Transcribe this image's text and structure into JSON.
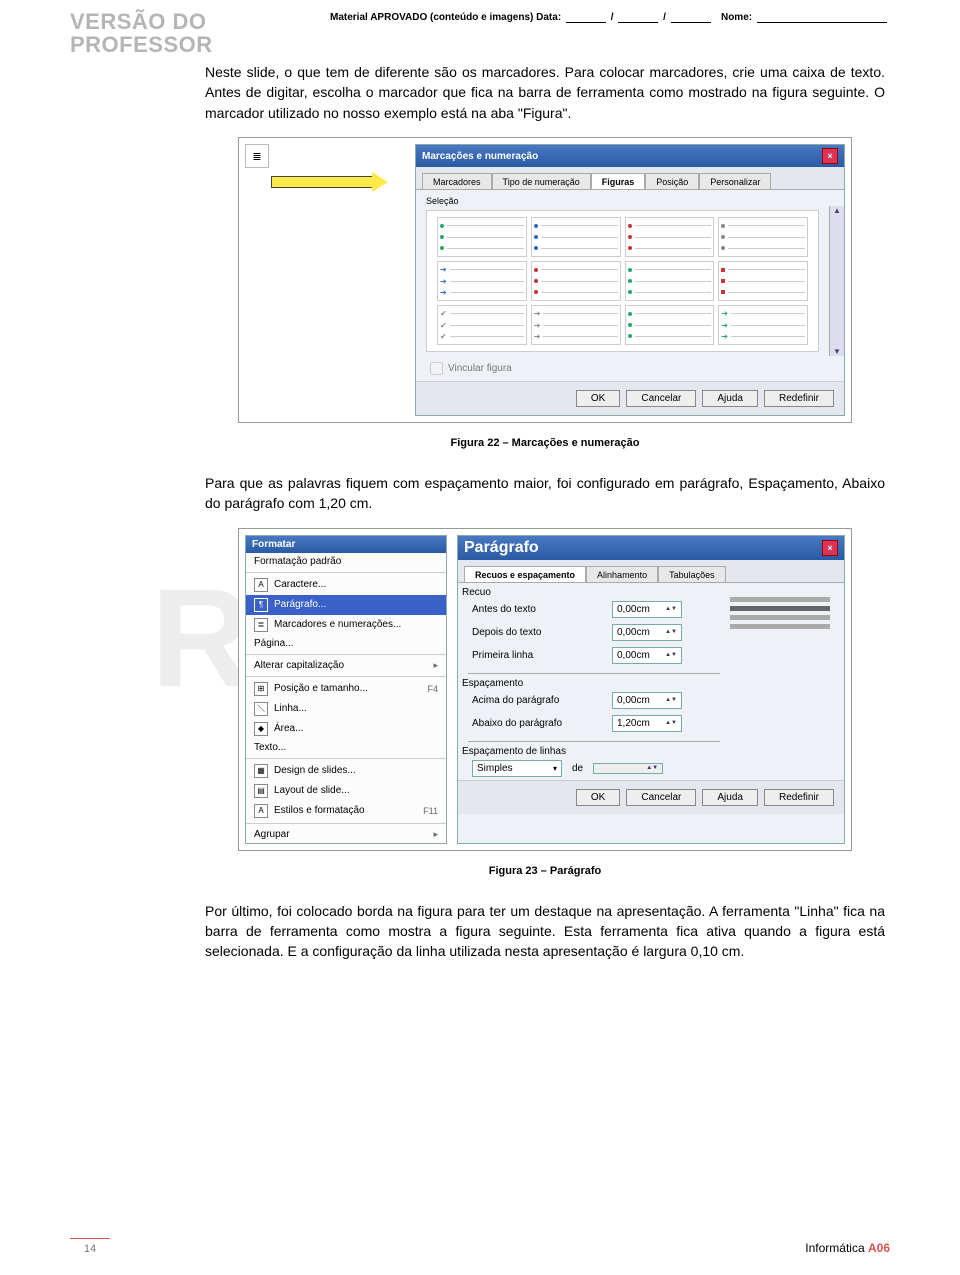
{
  "header": {
    "stamp_line1": "VERSÃO DO",
    "stamp_line2": "PROFESSOR",
    "approval_prefix": "Material APROVADO (conteúdo e imagens)  Data:",
    "approval_nome": "Nome:",
    "slash": "/"
  },
  "watermark": "REVISÃO",
  "para1": "Neste slide, o que tem de diferente são os marcadores. Para colocar marcadores, crie uma caixa de texto. Antes de digitar, escolha o marcador que fica na barra de ferramenta como mostrado na figura seguinte. O marcador utilizado no nosso exemplo está na aba \"Figura\".",
  "fig22": {
    "title": "Marcações e numeração",
    "tabs": [
      "Marcadores",
      "Tipo de numeração",
      "Figuras",
      "Posição",
      "Personalizar"
    ],
    "section": "Seleção",
    "link_check": "Vincular figura",
    "buttons": {
      "ok": "OK",
      "cancel": "Cancelar",
      "help": "Ajuda",
      "reset": "Redefinir"
    },
    "caption": "Figura 22 – Marcações e numeração"
  },
  "para2": "Para que as palavras fiquem com espaçamento maior, foi configurado em parágrafo, Espaçamento, Abaixo do parágrafo com 1,20 cm.",
  "fig23": {
    "menu_title": "Formatar",
    "menu_items": [
      "Formatação padrão",
      "Caractere...",
      "Parágrafo...",
      "Marcadores e numerações...",
      "Página...",
      "Alterar capitalização",
      "Posição e tamanho...",
      "Linha...",
      "Área...",
      "Texto...",
      "Design de slides...",
      "Layout de slide...",
      "Estilos e formatação",
      "Agrupar"
    ],
    "menu_short_f4": "F4",
    "menu_short_f11": "F11",
    "dlg_title": "Parágrafo",
    "dlg_tabs": [
      "Recuos e espaçamento",
      "Alinhamento",
      "Tabulações"
    ],
    "grp_recuo": "Recuo",
    "lbl_antes": "Antes do texto",
    "lbl_depois": "Depois do texto",
    "lbl_primeira": "Primeira linha",
    "grp_espac": "Espaçamento",
    "lbl_acima": "Acima do parágrafo",
    "lbl_abaixo": "Abaixo do parágrafo",
    "grp_linhas": "Espaçamento de linhas",
    "val_simples": "Simples",
    "v000": "0,00cm",
    "v120": "1,20cm",
    "de": "de",
    "buttons": {
      "ok": "OK",
      "cancel": "Cancelar",
      "help": "Ajuda",
      "reset": "Redefinir"
    },
    "caption": "Figura 23 – Parágrafo"
  },
  "para3": "Por último, foi colocado borda na figura para ter um destaque na apresentação. A ferramenta \"Linha\" fica na barra de ferramenta como mostra a figura seguinte. Esta ferramenta fica ativa quando a figura está selecionada. E a configuração da linha utilizada nesta apresentação é largura 0,10 cm.",
  "footer": {
    "page": "14",
    "subject": "Informática",
    "code": "A06"
  }
}
